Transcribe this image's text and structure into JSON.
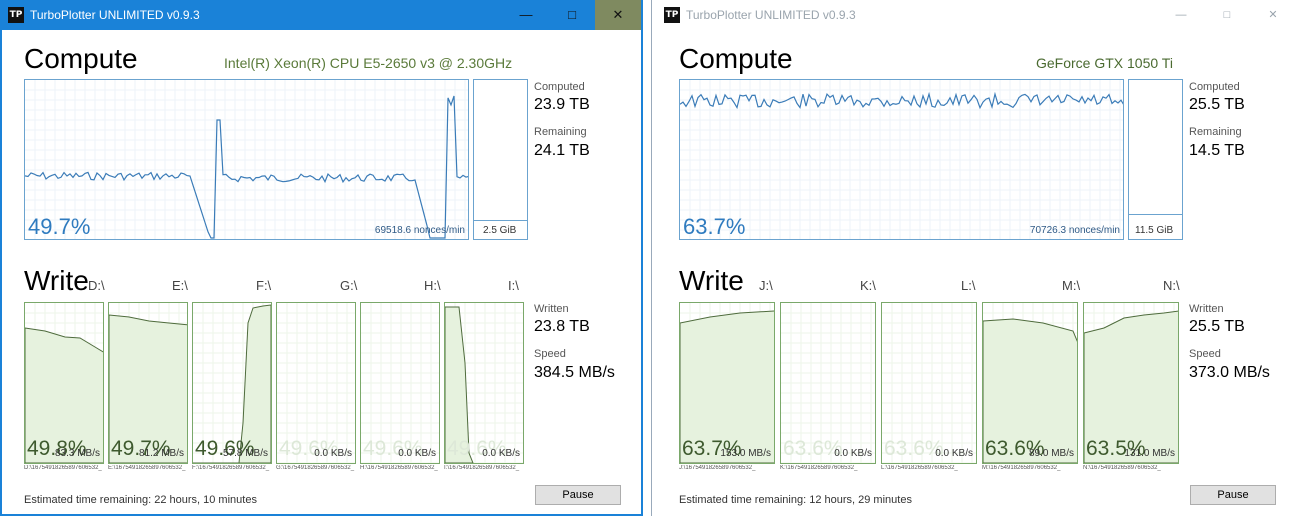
{
  "left": {
    "title": "TurboPlotter UNLIMITED v0.9.3",
    "controls": {
      "minimize": "—",
      "maximize": "□",
      "close": "✕"
    },
    "compute_heading": "Compute",
    "device": "Intel(R) Xeon(R) CPU E5-2650 v3 @ 2.30GHz",
    "compute_percent": "49.7%",
    "nonces": "69518.6 nonces/min",
    "memory": "2.5 GiB",
    "computed_label": "Computed",
    "computed_value": "23.9 TB",
    "remaining_label": "Remaining",
    "remaining_value": "24.1 TB",
    "write_heading": "Write",
    "written_label": "Written",
    "written_value": "23.8 TB",
    "speed_label": "Speed",
    "speed_value": "384.5 MB/s",
    "drives": [
      {
        "letter": "D:\\",
        "percent": "49.8%",
        "speed": "83.3 MB/s",
        "path": "D:\\16754918265897606532_",
        "faded": false
      },
      {
        "letter": "E:\\",
        "percent": "49.7%",
        "speed": "81.2 MB/s",
        "path": "E:\\16754918265897606532_",
        "faded": false
      },
      {
        "letter": "F:\\",
        "percent": "49.6%",
        "speed": "57.8 MB/s",
        "path": "F:\\16754918265897606532_",
        "faded": false
      },
      {
        "letter": "G:\\",
        "percent": "49.6%",
        "speed": "0.0 KB/s",
        "path": "G:\\16754918265897606532_",
        "faded": true
      },
      {
        "letter": "H:\\",
        "percent": "49.6%",
        "speed": "0.0 KB/s",
        "path": "H:\\16754918265897606532_",
        "faded": true
      },
      {
        "letter": "I:\\",
        "percent": "49.6%",
        "speed": "0.0 KB/s",
        "path": "I:\\16754918265897606532_",
        "faded": true
      }
    ],
    "estimated": "Estimated time remaining: 22 hours, 10 minutes",
    "pause_label": "Pause"
  },
  "right": {
    "title": "TurboPlotter UNLIMITED v0.9.3",
    "controls": {
      "minimize": "—",
      "maximize": "□",
      "close": "✕"
    },
    "compute_heading": "Compute",
    "device": "GeForce GTX 1050 Ti",
    "compute_percent": "63.7%",
    "nonces": "70726.3 nonces/min",
    "memory": "11.5 GiB",
    "computed_label": "Computed",
    "computed_value": "25.5 TB",
    "remaining_label": "Remaining",
    "remaining_value": "14.5 TB",
    "write_heading": "Write",
    "written_label": "Written",
    "written_value": "25.5 TB",
    "speed_label": "Speed",
    "speed_value": "373.0 MB/s",
    "drives": [
      {
        "letter": "J:\\",
        "percent": "63.7%",
        "speed": "153.0 MB/s",
        "path": "J:\\16754918265897606532_",
        "faded": false
      },
      {
        "letter": "K:\\",
        "percent": "63.6%",
        "speed": "0.0 KB/s",
        "path": "K:\\16754918265897606532_",
        "faded": true
      },
      {
        "letter": "L:\\",
        "percent": "63.6%",
        "speed": "0.0 KB/s",
        "path": "L:\\16754918265897606532_",
        "faded": true
      },
      {
        "letter": "M:\\",
        "percent": "63.6%",
        "speed": "89.0 MB/s",
        "path": "M:\\16754918265897606532_",
        "faded": false
      },
      {
        "letter": "N:\\",
        "percent": "63.5%",
        "speed": "131.0 MB/s",
        "path": "N:\\16754918265897606532_",
        "faded": false
      }
    ],
    "estimated": "Estimated time remaining: 12 hours, 29 minutes",
    "pause_label": "Pause"
  },
  "colors": {
    "accent": "#1a82d8",
    "compute_line": "#3b7cb8",
    "write_line": "#4e6b3c",
    "write_fill": "#e6f2de"
  }
}
